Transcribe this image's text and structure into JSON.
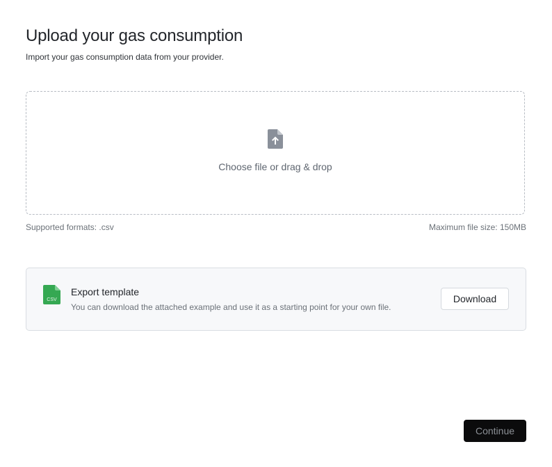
{
  "header": {
    "title": "Upload your gas consumption",
    "subtitle": "Import your gas consumption data from your provider."
  },
  "dropzone": {
    "icon": "file-upload-icon",
    "label": "Choose file or drag & drop",
    "supported_formats": "Supported formats: .csv",
    "max_size": "Maximum file size: 150MB"
  },
  "template": {
    "icon": "csv-file-icon",
    "icon_text": "CSV",
    "title": "Export template",
    "description": "You can download the attached example and use it as a starting point for your own file.",
    "download_label": "Download"
  },
  "footer": {
    "continue_label": "Continue"
  },
  "colors": {
    "csv_green": "#35a852",
    "upload_icon": "#8a909a",
    "continue_bg": "#0b0b0c"
  }
}
